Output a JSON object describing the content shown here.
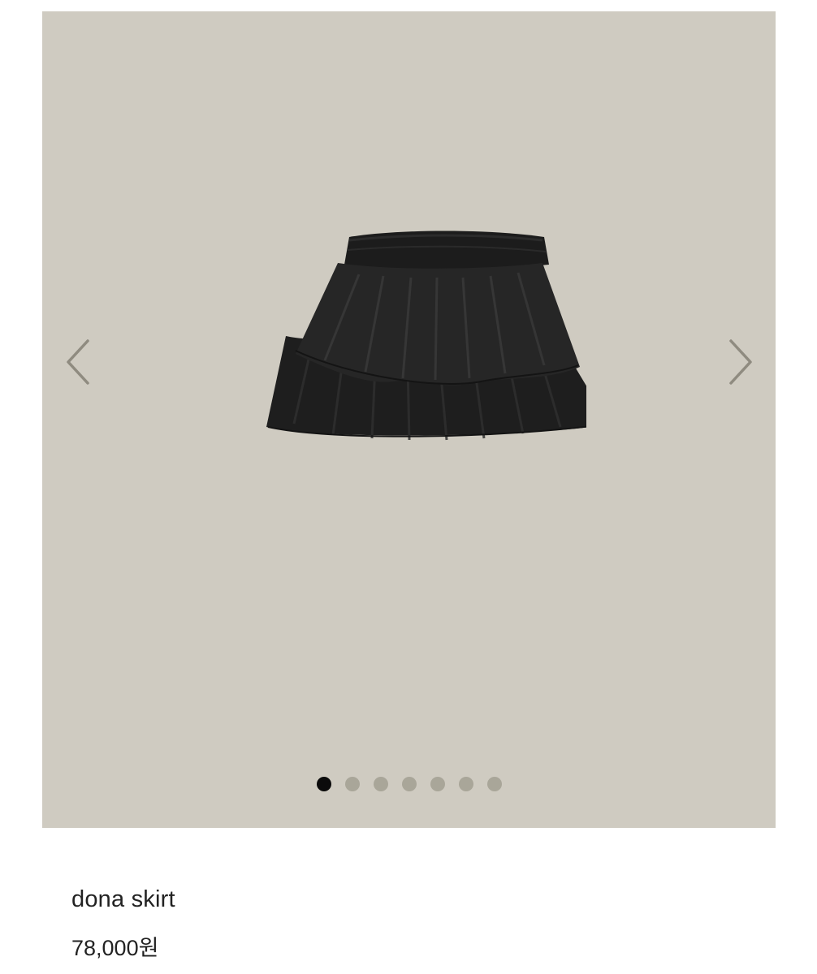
{
  "gallery": {
    "background_color": "#cfcbc1",
    "image_icon": "black-tiered-ruffle-skirt",
    "prev_icon": "chevron-left-icon",
    "next_icon": "chevron-right-icon",
    "slide_count": 7,
    "active_slide": 1,
    "dots": [
      {
        "state": "active"
      },
      {
        "state": "inactive"
      },
      {
        "state": "inactive"
      },
      {
        "state": "inactive"
      },
      {
        "state": "inactive"
      },
      {
        "state": "inactive"
      },
      {
        "state": "inactive"
      }
    ]
  },
  "product": {
    "name": "dona skirt",
    "price": "78,000원"
  }
}
